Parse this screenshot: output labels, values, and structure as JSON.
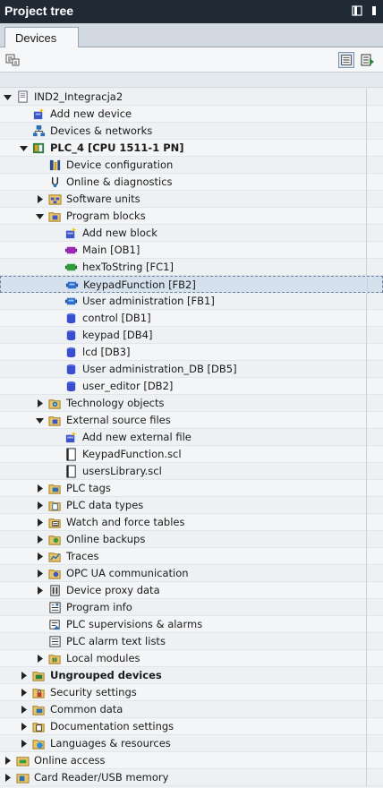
{
  "titlebar": {
    "title": "Project tree"
  },
  "tab": {
    "label": "Devices"
  },
  "tree": [
    {
      "label": "IND2_Integracja2",
      "level": 0,
      "toggle": "expanded",
      "icon": "project-icon",
      "bold": false
    },
    {
      "label": "Add new device",
      "level": 1,
      "toggle": "none",
      "icon": "add-device-icon",
      "bold": false
    },
    {
      "label": "Devices & networks",
      "level": 1,
      "toggle": "none",
      "icon": "network-icon",
      "bold": false
    },
    {
      "label": "PLC_4 [CPU 1511-1 PN]",
      "level": 1,
      "toggle": "expanded",
      "icon": "plc-icon",
      "bold": true
    },
    {
      "label": "Device configuration",
      "level": 2,
      "toggle": "none",
      "icon": "device-config-icon",
      "bold": false
    },
    {
      "label": "Online & diagnostics",
      "level": 2,
      "toggle": "none",
      "icon": "diagnostics-icon",
      "bold": false
    },
    {
      "label": "Software units",
      "level": 2,
      "toggle": "collapsed",
      "icon": "software-units-icon",
      "bold": false
    },
    {
      "label": "Program blocks",
      "level": 2,
      "toggle": "expanded",
      "icon": "folder-icon",
      "bold": false
    },
    {
      "label": "Add new block",
      "level": 3,
      "toggle": "none",
      "icon": "add-block-icon",
      "bold": false
    },
    {
      "label": "Main [OB1]",
      "level": 3,
      "toggle": "none",
      "icon": "ob-block-icon",
      "bold": false
    },
    {
      "label": "hexToString [FC1]",
      "level": 3,
      "toggle": "none",
      "icon": "fc-block-icon",
      "bold": false
    },
    {
      "label": "KeypadFunction [FB2]",
      "level": 3,
      "toggle": "none",
      "icon": "fb-block-icon",
      "bold": false,
      "selected": true
    },
    {
      "label": "User administration [FB1]",
      "level": 3,
      "toggle": "none",
      "icon": "fb-block-icon",
      "bold": false
    },
    {
      "label": "control [DB1]",
      "level": 3,
      "toggle": "none",
      "icon": "db-block-icon",
      "bold": false
    },
    {
      "label": "keypad [DB4]",
      "level": 3,
      "toggle": "none",
      "icon": "db-block-icon",
      "bold": false
    },
    {
      "label": "lcd [DB3]",
      "level": 3,
      "toggle": "none",
      "icon": "db-block-icon",
      "bold": false
    },
    {
      "label": "User administration_DB [DB5]",
      "level": 3,
      "toggle": "none",
      "icon": "db-block-icon",
      "bold": false
    },
    {
      "label": "user_editor [DB2]",
      "level": 3,
      "toggle": "none",
      "icon": "db-block-icon",
      "bold": false
    },
    {
      "label": "Technology objects",
      "level": 2,
      "toggle": "collapsed",
      "icon": "technology-icon",
      "bold": false
    },
    {
      "label": "External source files",
      "level": 2,
      "toggle": "expanded",
      "icon": "folder-icon",
      "bold": false
    },
    {
      "label": "Add new external file",
      "level": 3,
      "toggle": "none",
      "icon": "add-block-icon",
      "bold": false
    },
    {
      "label": "KeypadFunction.scl",
      "level": 3,
      "toggle": "none",
      "icon": "file-icon",
      "bold": false
    },
    {
      "label": "usersLibrary.scl",
      "level": 3,
      "toggle": "none",
      "icon": "file-icon",
      "bold": false
    },
    {
      "label": "PLC tags",
      "level": 2,
      "toggle": "collapsed",
      "icon": "plc-tags-icon",
      "bold": false
    },
    {
      "label": "PLC data types",
      "level": 2,
      "toggle": "collapsed",
      "icon": "data-types-icon",
      "bold": false
    },
    {
      "label": "Watch and force tables",
      "level": 2,
      "toggle": "collapsed",
      "icon": "watch-table-icon",
      "bold": false
    },
    {
      "label": "Online backups",
      "level": 2,
      "toggle": "collapsed",
      "icon": "backup-icon",
      "bold": false
    },
    {
      "label": "Traces",
      "level": 2,
      "toggle": "collapsed",
      "icon": "traces-icon",
      "bold": false
    },
    {
      "label": "OPC UA communication",
      "level": 2,
      "toggle": "collapsed",
      "icon": "opcua-icon",
      "bold": false
    },
    {
      "label": "Device proxy data",
      "level": 2,
      "toggle": "collapsed",
      "icon": "proxy-data-icon",
      "bold": false
    },
    {
      "label": "Program info",
      "level": 2,
      "toggle": "none",
      "icon": "program-info-icon",
      "bold": false
    },
    {
      "label": "PLC supervisions & alarms",
      "level": 2,
      "toggle": "none",
      "icon": "alarms-icon",
      "bold": false
    },
    {
      "label": "PLC alarm text lists",
      "level": 2,
      "toggle": "none",
      "icon": "text-list-icon",
      "bold": false
    },
    {
      "label": "Local modules",
      "level": 2,
      "toggle": "collapsed",
      "icon": "local-modules-icon",
      "bold": false
    },
    {
      "label": "Ungrouped devices",
      "level": 1,
      "toggle": "collapsed",
      "icon": "ungrouped-devices-icon",
      "bold": true
    },
    {
      "label": "Security settings",
      "level": 1,
      "toggle": "collapsed",
      "icon": "security-icon",
      "bold": false
    },
    {
      "label": "Common data",
      "level": 1,
      "toggle": "collapsed",
      "icon": "common-data-icon",
      "bold": false
    },
    {
      "label": "Documentation settings",
      "level": 1,
      "toggle": "collapsed",
      "icon": "documentation-icon",
      "bold": false
    },
    {
      "label": "Languages & resources",
      "level": 1,
      "toggle": "collapsed",
      "icon": "languages-icon",
      "bold": false
    },
    {
      "label": "Online access",
      "level": 0,
      "toggle": "collapsed",
      "icon": "online-access-icon",
      "bold": false
    },
    {
      "label": "Card Reader/USB memory",
      "level": 0,
      "toggle": "collapsed",
      "icon": "card-reader-icon",
      "bold": false
    }
  ]
}
